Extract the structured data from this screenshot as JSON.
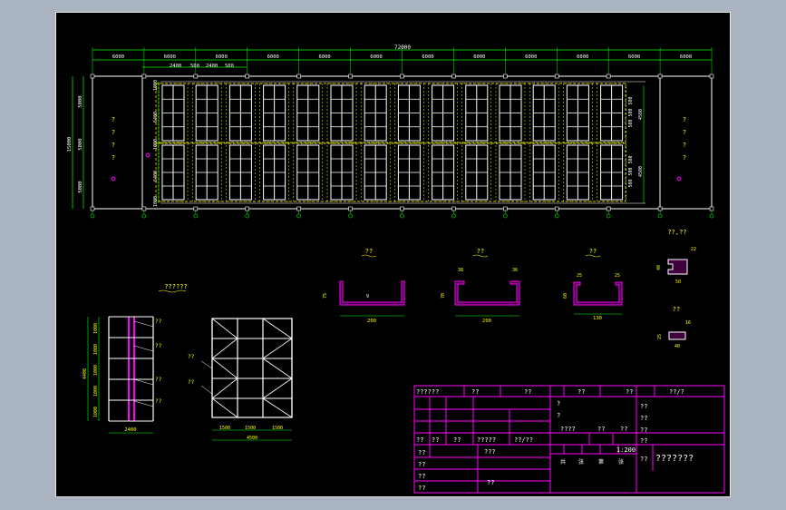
{
  "plan": {
    "overall_width": "72000",
    "bay_dims": [
      "6000",
      "6000",
      "6000",
      "6000",
      "6000",
      "6000",
      "6000",
      "6000",
      "6000",
      "6000",
      "6000",
      "6000"
    ],
    "sub_dims": [
      "2400",
      "500",
      "2400",
      "500"
    ],
    "left_dims": [
      "5000",
      "5000",
      "5000"
    ],
    "overall_height": "15000",
    "left_room_text": [
      "?",
      "?",
      "?",
      "?"
    ],
    "right_room_text": [
      "?",
      "?",
      "?",
      "?"
    ],
    "right_dims_top": [
      "500",
      "500",
      "500",
      "4500"
    ],
    "right_dims_bottom": [
      "500",
      "500",
      "500",
      "4500"
    ],
    "inner_left_dims": [
      "1000",
      "6400",
      "1000",
      "6400",
      "1000"
    ]
  },
  "sections": {
    "title_1": "??",
    "title_2": "??",
    "title_3": "??",
    "title_4": "??,??",
    "title_5": "??",
    "c_channel_1": {
      "height": "75",
      "lip": "9",
      "width": "200"
    },
    "c_channel_2": {
      "height": "70",
      "lip_l": "38",
      "lip_r": "36",
      "width": "200"
    },
    "c_channel_3": {
      "height": "60",
      "lip_l": "25",
      "lip_r": "25",
      "width": "130"
    },
    "small_1": {
      "height": "40",
      "lip": "22",
      "width": "50"
    },
    "small_2": {
      "height": "25",
      "lip": "16",
      "width": "40"
    }
  },
  "rack": {
    "title": "??????",
    "side_labels": [
      "??",
      "??",
      "??",
      "??"
    ],
    "side_dims": [
      "1000",
      "1000",
      "1000",
      "1000",
      "1000"
    ],
    "side_total": "4400",
    "side_width": "2400",
    "front_labels": [
      "??",
      "??"
    ],
    "front_dims": [
      "1500",
      "1500",
      "1500"
    ],
    "front_total": "4500"
  },
  "title_block": {
    "row1": [
      "??????",
      "??",
      "??",
      "??",
      "??",
      "??/?"
    ],
    "q1": "?",
    "q2": "?",
    "q3": "??",
    "q4": "??",
    "q5": "??",
    "row_mid": [
      "????",
      "??",
      "??",
      "??"
    ],
    "row_left": [
      "??",
      "??",
      "??",
      "?????",
      "??/??"
    ],
    "scale": "1:200",
    "sheet_labels": [
      "共",
      "张",
      "第",
      "张"
    ],
    "drawing_title": "???????",
    "left_col": [
      "??",
      "??",
      "??",
      "??",
      "??"
    ],
    "sign_1": "???",
    "sign_2": "??"
  }
}
